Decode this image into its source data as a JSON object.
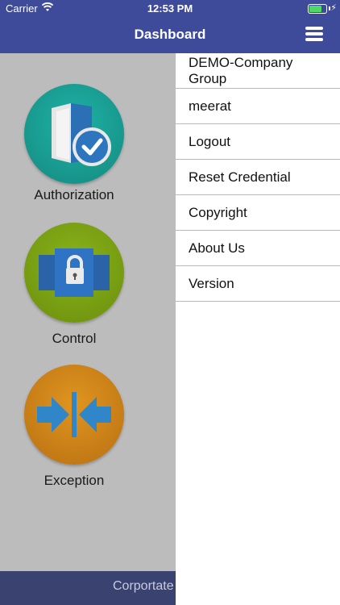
{
  "status_bar": {
    "carrier": "Carrier",
    "time": "12:53 PM"
  },
  "nav": {
    "title": "Dashboard",
    "menu_icon": "hamburger-menu-icon"
  },
  "tiles": [
    {
      "label": "Authorization",
      "icon": "folder-check-icon",
      "color": "#17a398"
    },
    {
      "label": "Control",
      "icon": "padlock-icon",
      "color": "#7aa012"
    },
    {
      "label": "Exception",
      "icon": "arrows-converge-icon",
      "color": "#d9891a"
    }
  ],
  "footer": {
    "text": "Corportate"
  },
  "side_menu": {
    "items": [
      {
        "label": "DEMO-Company Group"
      },
      {
        "label": "meerat"
      },
      {
        "label": "Logout"
      },
      {
        "label": "Reset Credential"
      },
      {
        "label": "Copyright"
      },
      {
        "label": "About Us"
      },
      {
        "label": "Version"
      }
    ]
  },
  "colors": {
    "nav_bar": "#3e4a9a",
    "footer": "#3a4270",
    "overlay": "#bcbcbc",
    "battery": "#4cd964"
  }
}
